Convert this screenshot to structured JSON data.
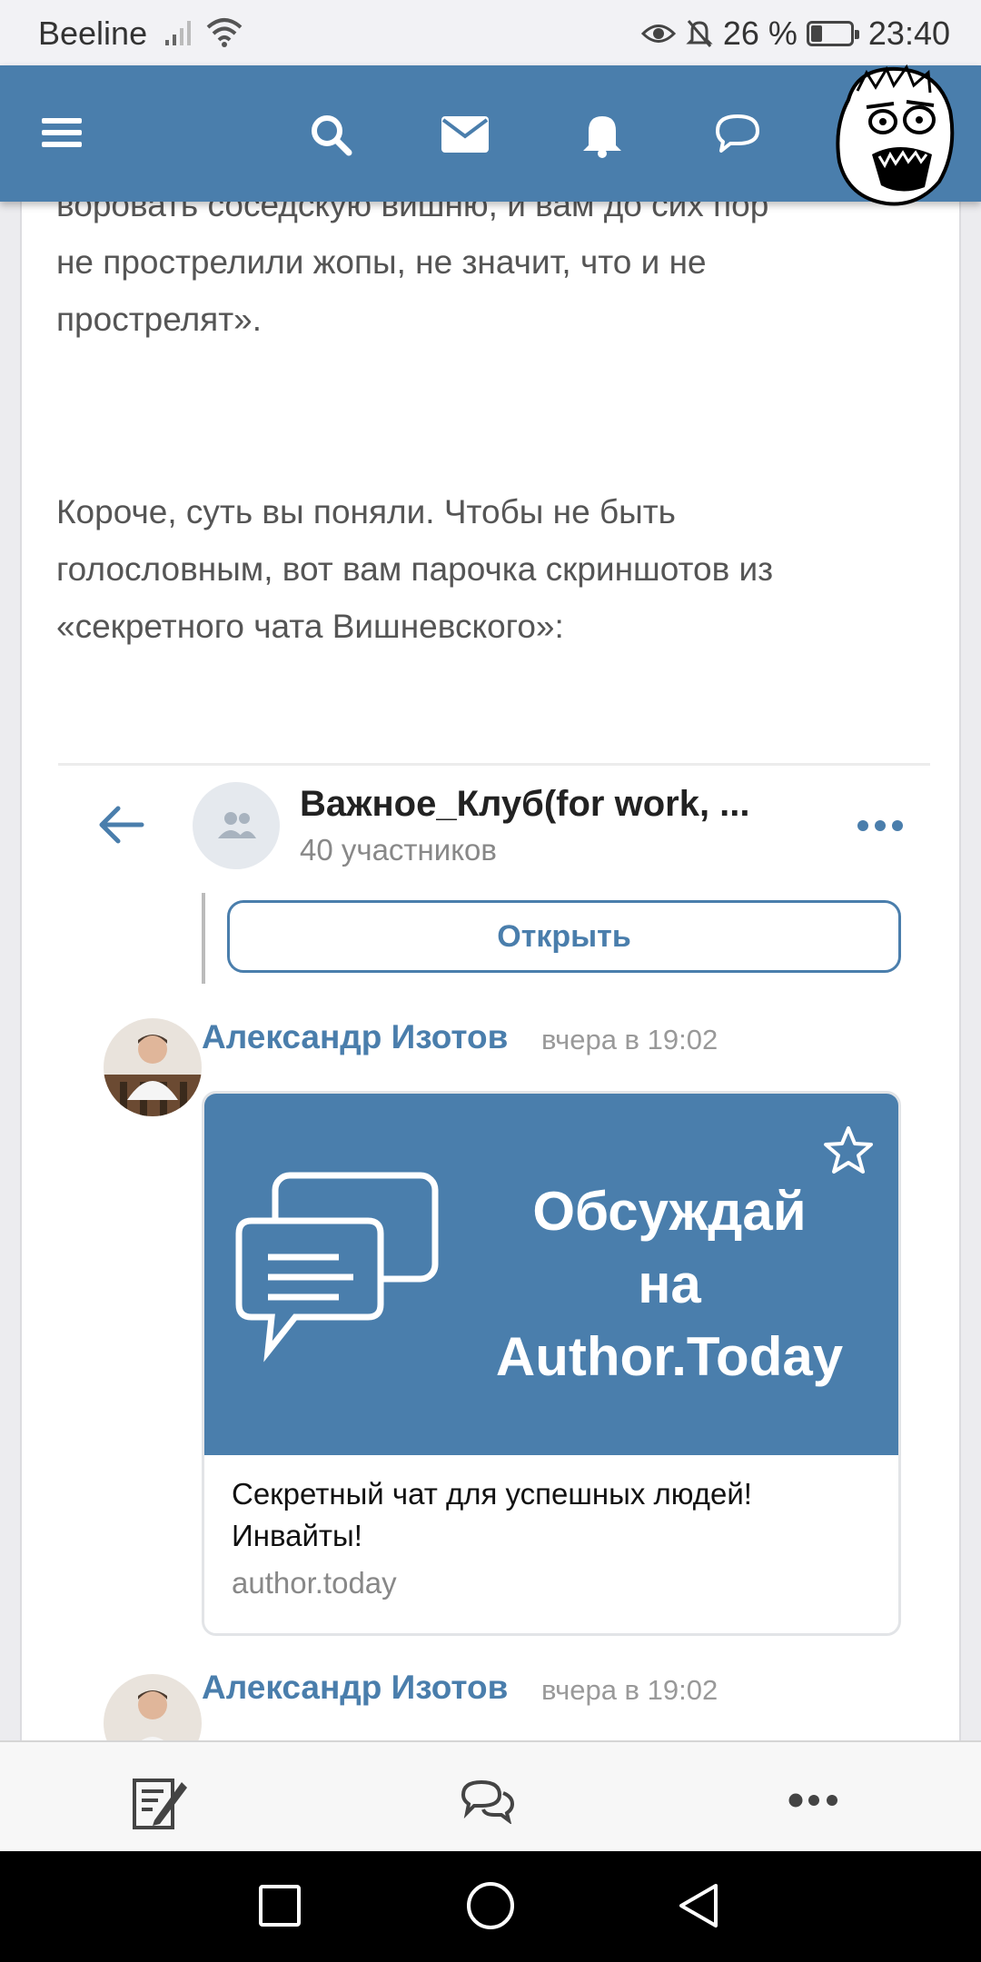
{
  "status": {
    "carrier": "Beeline",
    "battery_percent": "26 %",
    "time": "23:40"
  },
  "topnav": {
    "icons": [
      "menu-icon",
      "search-icon",
      "mail-icon",
      "bell-icon",
      "chat-bubble-icon"
    ]
  },
  "article": {
    "para1_lines": [
      "воровать соседскую вишню, и вам до сих пор",
      "не прострелили жопы, не значит, что и не",
      "прострелят»."
    ],
    "para2_lines": [
      "Короче, суть вы поняли. Чтобы не быть",
      "голословным, вот вам парочка скриншотов из",
      "«секретного чата Вишневского»:"
    ]
  },
  "embed": {
    "chat_title": "Важное_Клуб(for work, ...",
    "chat_members": "40 участников",
    "open_button": "Открыть",
    "messages": [
      {
        "sender": "Александр Изотов",
        "time": "вчера в 19:02",
        "banner_lines": [
          "Обсуждай",
          "на",
          "Author.Today"
        ],
        "link_title_lines": [
          "Секретный чат для успешных людей!",
          "Инвайты!"
        ],
        "link_domain": "author.today"
      },
      {
        "sender": "Александр Изотов",
        "time": "вчера в 19:02"
      }
    ]
  },
  "colors": {
    "brand": "#4a7eac",
    "text": "#555555"
  }
}
